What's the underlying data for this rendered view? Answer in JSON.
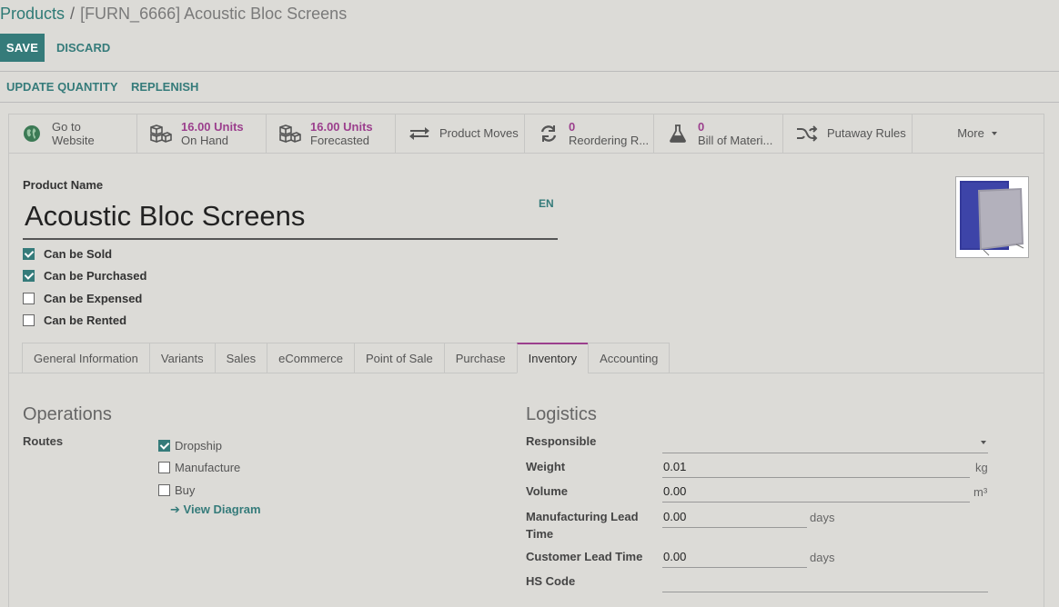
{
  "breadcrumb": {
    "parent": "Products",
    "separator": "/",
    "current": "[FURN_6666] Acoustic Bloc Screens"
  },
  "toolbar": {
    "save_label": "SAVE",
    "discard_label": "DISCARD",
    "update_quantity_label": "UPDATE QUANTITY",
    "replenish_label": "REPLENISH"
  },
  "stats": [
    {
      "icon": "globe-icon",
      "line1": "Go to",
      "line2": "Website"
    },
    {
      "icon": "cubes-icon",
      "line1": "16.00 Units",
      "line2": "On Hand"
    },
    {
      "icon": "cubes-icon",
      "line1": "16.00 Units",
      "line2": "Forecasted"
    },
    {
      "icon": "exchange-icon",
      "line1": "Product Moves",
      "line2": ""
    },
    {
      "icon": "refresh-icon",
      "line1": "0",
      "line2": "Reordering R..."
    },
    {
      "icon": "flask-icon",
      "line1": "0",
      "line2": "Bill of Materi..."
    },
    {
      "icon": "random-icon",
      "line1": "Putaway Rules",
      "line2": ""
    },
    {
      "icon": "caret-down-icon",
      "line1": "More",
      "line2": ""
    }
  ],
  "product": {
    "name_label": "Product Name",
    "name": "Acoustic Bloc Screens",
    "lang": "EN",
    "flags": [
      {
        "label": "Can be Sold",
        "checked": true
      },
      {
        "label": "Can be Purchased",
        "checked": true
      },
      {
        "label": "Can be Expensed",
        "checked": false
      },
      {
        "label": "Can be Rented",
        "checked": false
      }
    ]
  },
  "tabs": [
    {
      "label": "General Information",
      "active": false
    },
    {
      "label": "Variants",
      "active": false
    },
    {
      "label": "Sales",
      "active": false
    },
    {
      "label": "eCommerce",
      "active": false
    },
    {
      "label": "Point of Sale",
      "active": false
    },
    {
      "label": "Purchase",
      "active": false
    },
    {
      "label": "Inventory",
      "active": true
    },
    {
      "label": "Accounting",
      "active": false
    }
  ],
  "operations": {
    "title": "Operations",
    "routes_label": "Routes",
    "routes": [
      {
        "label": "Dropship",
        "checked": true
      },
      {
        "label": "Manufacture",
        "checked": false
      },
      {
        "label": "Buy",
        "checked": false
      }
    ],
    "view_diagram": "View Diagram"
  },
  "logistics": {
    "title": "Logistics",
    "responsible_label": "Responsible",
    "responsible_value": "",
    "weight_label": "Weight",
    "weight_value": "0.01",
    "weight_unit": "kg",
    "volume_label": "Volume",
    "volume_value": "0.00",
    "volume_unit": "m³",
    "mfg_lead_label_1": "Manufacturing Lead",
    "mfg_lead_label_2": "Time",
    "mfg_lead_value": "0.00",
    "mfg_lead_unit": "days",
    "cust_lead_label": "Customer Lead Time",
    "cust_lead_value": "0.00",
    "cust_lead_unit": "days",
    "hs_code_label": "HS Code",
    "hs_code_value": ""
  },
  "colors": {
    "primary": "#357b7a",
    "accent": "#9b3f8d",
    "background": "#dcdbd7"
  }
}
